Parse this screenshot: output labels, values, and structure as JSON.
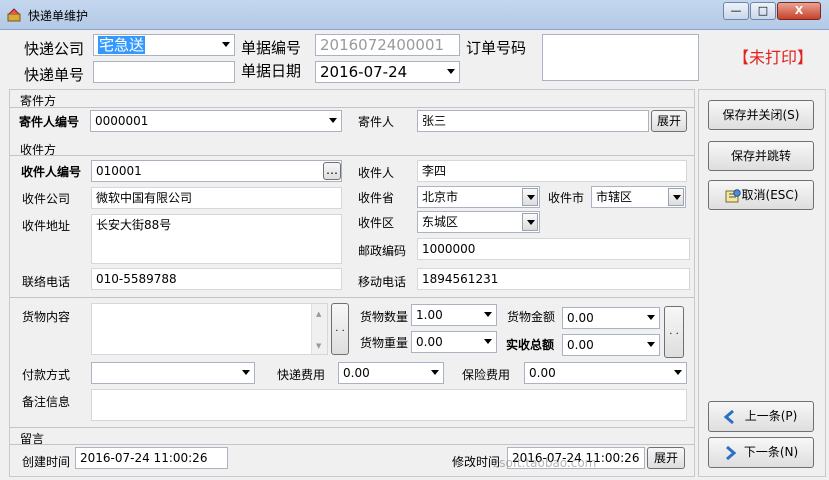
{
  "window": {
    "title": "快递单维护",
    "min": "—",
    "max": "□",
    "close": "X"
  },
  "header": {
    "express_company_label": "快递公司",
    "express_company_value": "宅急送",
    "bill_no_label": "单据编号",
    "bill_no_value": "2016072400001",
    "order_no_label": "订单号码",
    "order_no_value": "",
    "tracking_no_label": "快递单号",
    "tracking_no_value": "",
    "bill_date_label": "单据日期",
    "bill_date_value": "2016-07-24",
    "print_status": "【未打印】"
  },
  "sender": {
    "section": "寄件方",
    "code_label": "寄件人编号",
    "code_value": "0000001",
    "name_label": "寄件人",
    "name_value": "张三",
    "expand": "展开"
  },
  "receiver": {
    "section": "收件方",
    "code_label": "收件人编号",
    "code_value": "010001",
    "name_label": "收件人",
    "name_value": "李四",
    "company_label": "收件公司",
    "company_value": "微软中国有限公司",
    "province_label": "收件省",
    "province_value": "北京市",
    "city_label": "收件市",
    "city_value": "市辖区",
    "address_label": "收件地址",
    "address_value": "长安大街88号",
    "district_label": "收件区",
    "district_value": "东城区",
    "postcode_label": "邮政编码",
    "postcode_value": "1000000",
    "phone_label": "联络电话",
    "phone_value": "010-5589788",
    "mobile_label": "移动电话",
    "mobile_value": "1894561231"
  },
  "goods": {
    "content_label": "货物内容",
    "content_value": "",
    "qty_label": "货物数量",
    "qty_value": "1.00",
    "amount_label": "货物金额",
    "amount_value": "0.00",
    "weight_label": "货物重量",
    "weight_value": "0.00",
    "total_label": "实收总额",
    "total_value": "0.00",
    "payment_label": "付款方式",
    "payment_value": "",
    "fee_label": "快递费用",
    "fee_value": "0.00",
    "insurance_label": "保险费用",
    "insurance_value": "0.00",
    "remark_label": "备注信息",
    "remark_value": ""
  },
  "footer": {
    "message_label": "留言",
    "created_label": "创建时间",
    "created_value": "2016-07-24 11:00:26",
    "modified_label": "修改时间",
    "modified_value": "2016-07-24 11:00:26",
    "expand": "展开",
    "watermark": "zsoft.taobao.com"
  },
  "actions": {
    "save_close": "保存并关闭(S)",
    "save_jump": "保存并跳转",
    "cancel": "取消(ESC)",
    "prev": "上一条(P)",
    "next": "下一条(N)",
    "ellipsis": "…",
    "dots": ". ."
  }
}
